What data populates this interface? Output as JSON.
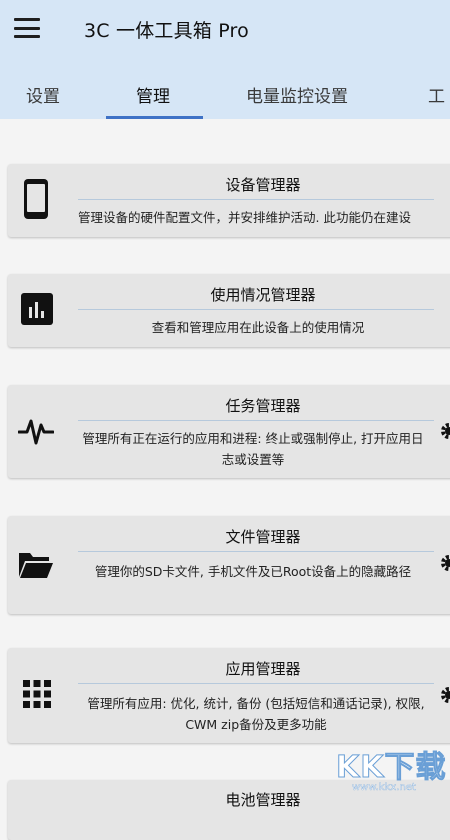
{
  "app": {
    "title": "3C 一体工具箱 Pro",
    "appbar_color": "#d6e6f6",
    "accent_color": "#3f72c6"
  },
  "tabs": [
    {
      "label": "设置",
      "active": false
    },
    {
      "label": "管理",
      "active": true
    },
    {
      "label": "电量监控设置",
      "active": false
    },
    {
      "label": "工",
      "active": false
    }
  ],
  "cards": [
    {
      "icon": "phone-icon",
      "title": "设备管理器",
      "description": "管理设备的硬件配置文件，并安排维护活动. 此功能仍在建设"
    },
    {
      "icon": "bar-chart-icon",
      "title": "使用情况管理器",
      "description": "查看和管理应用在此设备上的使用情况"
    },
    {
      "icon": "pulse-icon",
      "title": "任务管理器",
      "description": "管理所有正在运行的应用和进程: 终止或强制停止, 打开应用日志或设置等"
    },
    {
      "icon": "folder-icon",
      "title": "文件管理器",
      "description": "管理你的SD卡文件, 手机文件及已Root设备上的隐藏路径"
    },
    {
      "icon": "apps-grid-icon",
      "title": "应用管理器",
      "description": "管理所有应用: 优化, 统计, 备份 (包括短信和通话记录), 权限, CWM zip备份及更多功能"
    },
    {
      "icon": "battery-icon",
      "title": "电池管理器",
      "description": ""
    }
  ],
  "watermark": {
    "brand": "KK下载",
    "url": "www.kkx.net"
  }
}
